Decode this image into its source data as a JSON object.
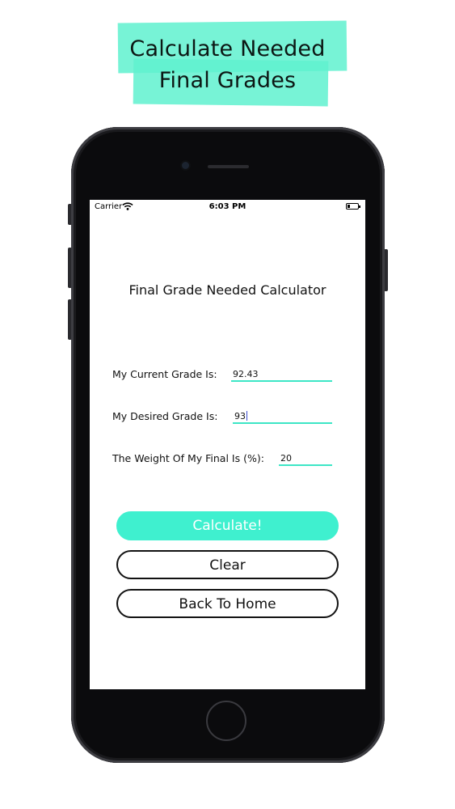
{
  "promo": {
    "headline_line1": "Calculate Needed",
    "headline_line2": "Final Grades",
    "accent_color": "#5ff1cf"
  },
  "status_bar": {
    "carrier": "Carrier",
    "time": "6:03 PM"
  },
  "screen": {
    "title": "Final Grade Needed Calculator",
    "fields": [
      {
        "label": "My Current Grade Is:",
        "value": "92.43"
      },
      {
        "label": "My Desired Grade Is:",
        "value": "93"
      },
      {
        "label": "The Weight Of My Final Is (%):",
        "value": "20"
      }
    ],
    "buttons": {
      "calculate": "Calculate!",
      "clear": "Clear",
      "back_home": "Back To Home"
    },
    "accent_color": "#3ff0cf"
  }
}
